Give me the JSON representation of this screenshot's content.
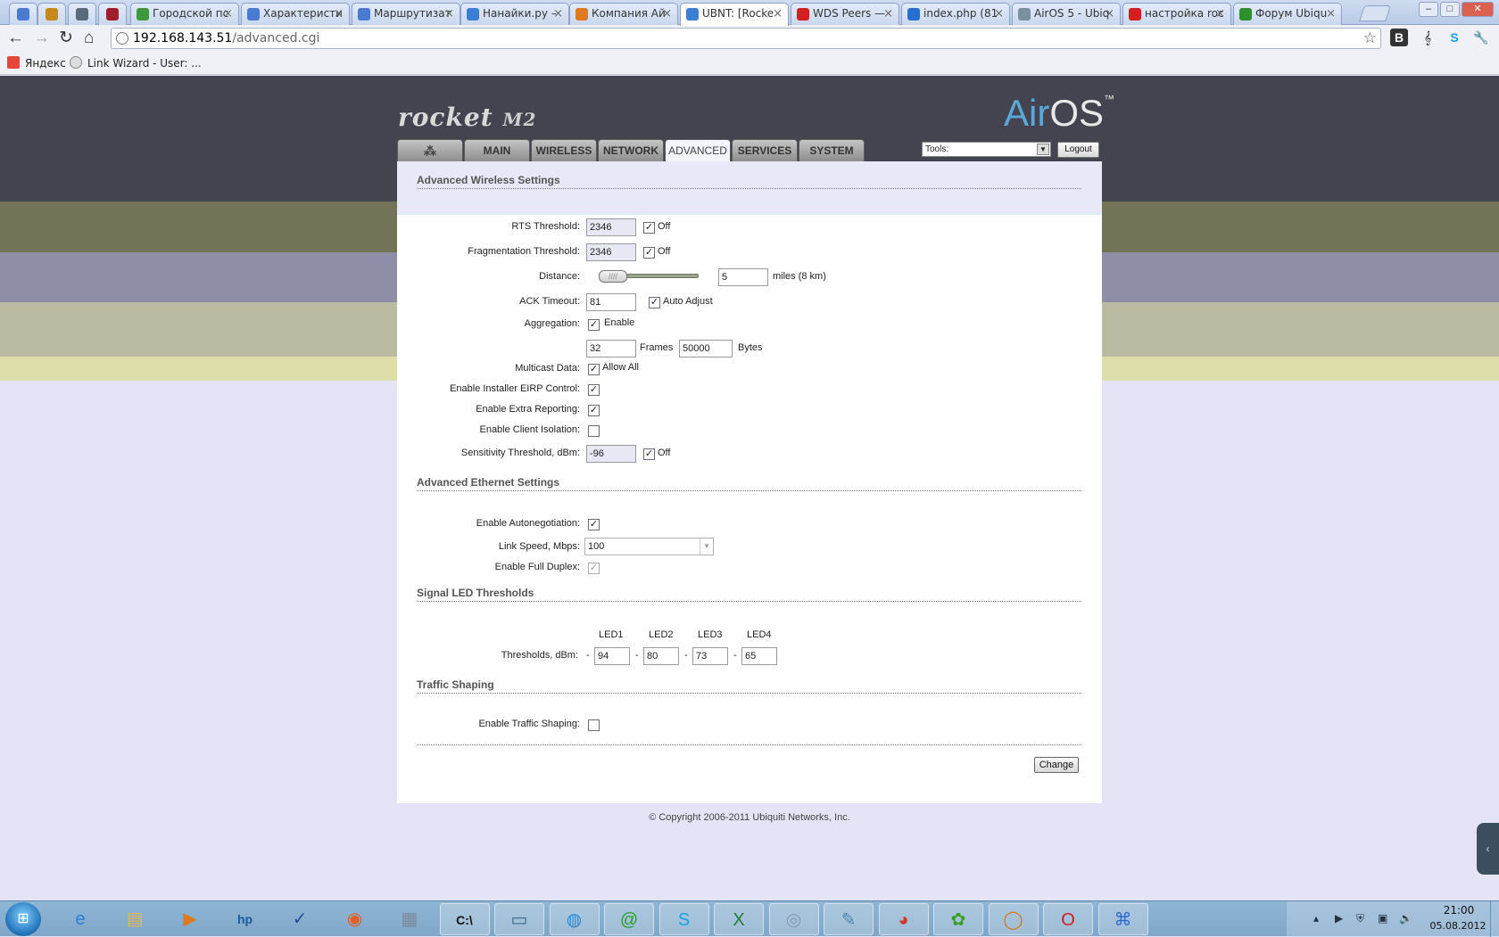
{
  "browser": {
    "tabs": [
      {
        "title": "",
        "icon": "generic-page-icon",
        "color": "#4a7bd0"
      },
      {
        "title": "",
        "icon": "emblem-icon",
        "color": "#c58a1a"
      },
      {
        "title": "",
        "icon": "building-icon",
        "color": "#5a6a7a"
      },
      {
        "title": "",
        "icon": "vote-icon",
        "color": "#9c1f2b"
      },
      {
        "title": "Городской пс",
        "icon": "figure-icon",
        "color": "#3b9a3b"
      },
      {
        "title": "Характеристи",
        "icon": "document-icon",
        "color": "#4a7bd0"
      },
      {
        "title": "Маршрутизат",
        "icon": "document-icon",
        "color": "#4a7bd0"
      },
      {
        "title": "Нанайки.ру –",
        "icon": "wifi-icon",
        "color": "#3a7fd5"
      },
      {
        "title": "Компания Ай",
        "icon": "circle-icon",
        "color": "#e07a1f"
      },
      {
        "title": "UBNT: [Rocke",
        "icon": "wifi-icon",
        "color": "#3a7fd5"
      },
      {
        "title": "WDS Peers —",
        "icon": "yandex-icon",
        "color": "#d21f1f"
      },
      {
        "title": "index.php (81",
        "icon": "nag-icon",
        "color": "#2a6fd0"
      },
      {
        "title": "AirOS 5 - Ubiq",
        "icon": "ubnt-icon",
        "color": "#7a8fa0"
      },
      {
        "title": "настройка roc",
        "icon": "yandex-icon",
        "color": "#d21f1f"
      },
      {
        "title": "Форум Ubiqu",
        "icon": "forum-icon",
        "color": "#2f8f2f"
      }
    ],
    "active_tab_index": 9,
    "window_buttons": [
      "–",
      "□",
      "✕"
    ],
    "nav": {
      "back": "←",
      "forward": "→",
      "reload": "↻",
      "home": "⌂"
    },
    "url_host": "192.168.143.51",
    "url_path": "/advanced.cgi",
    "star": "☆",
    "extensions": [
      {
        "glyph": "В",
        "icon": "vk-icon"
      },
      {
        "glyph": "𝄞",
        "icon": "music-icon"
      },
      {
        "glyph": "S",
        "icon": "skype-icon"
      },
      {
        "glyph": "🔧",
        "icon": "wrench-icon"
      }
    ],
    "bookmarks": [
      {
        "label": "Яндекс",
        "icon": "yandex-icon"
      },
      {
        "label": "Link Wizard - User: ...",
        "icon": "globe-icon"
      }
    ]
  },
  "airos": {
    "logo_rocket": "rocket",
    "logo_model": "M2",
    "logo_air": "Air",
    "logo_os": "OS",
    "logo_tm": "™",
    "nav_tabs": [
      {
        "label": "",
        "icon": "ubiquiti-logo-icon"
      },
      {
        "label": "MAIN"
      },
      {
        "label": "WIRELESS"
      },
      {
        "label": "NETWORK"
      },
      {
        "label": "ADVANCED"
      },
      {
        "label": "SERVICES"
      },
      {
        "label": "SYSTEM"
      }
    ],
    "active_nav_index": 4,
    "tools_label": "Tools:",
    "logout_label": "Logout",
    "accent": "#5aa8d8"
  },
  "wireless": {
    "title": "Advanced Wireless Settings",
    "rts_label": "RTS Threshold:",
    "rts_value": "2346",
    "rts_off_label": "Off",
    "frag_label": "Fragmentation Threshold:",
    "frag_value": "2346",
    "frag_off_label": "Off",
    "distance_label": "Distance:",
    "distance_value": "5",
    "distance_unit": "miles (8 km)",
    "ack_label": "ACK Timeout:",
    "ack_value": "81",
    "ack_auto_label": "Auto Adjust",
    "aggregation_label": "Aggregation:",
    "aggregation_enable_label": "Enable",
    "frames_value": "32",
    "frames_label": "Frames",
    "bytes_value": "50000",
    "bytes_label": "Bytes",
    "multicast_label": "Multicast Data:",
    "multicast_allow_label": "Allow All",
    "eirp_label": "Enable Installer EIRP Control:",
    "extra_reporting_label": "Enable Extra Reporting:",
    "client_isolation_label": "Enable Client Isolation:",
    "sensitivity_label": "Sensitivity Threshold, dBm:",
    "sensitivity_value": "-96",
    "sensitivity_off_label": "Off"
  },
  "ethernet": {
    "title": "Advanced Ethernet Settings",
    "autoneg_label": "Enable Autonegotiation:",
    "link_speed_label": "Link Speed, Mbps:",
    "link_speed_value": "100",
    "full_duplex_label": "Enable Full Duplex:"
  },
  "led": {
    "title": "Signal LED Thresholds",
    "headers": [
      "LED1",
      "LED2",
      "LED3",
      "LED4"
    ],
    "thresholds_label": "Thresholds, dBm:",
    "dash": "-",
    "values": [
      "94",
      "80",
      "73",
      "65"
    ]
  },
  "traffic": {
    "title": "Traffic Shaping",
    "enable_label": "Enable Traffic Shaping:"
  },
  "change_label": "Change",
  "copyright": "© Copyright 2006-2011 Ubiquiti Networks, Inc.",
  "taskbar": {
    "apps": [
      {
        "icon": "ie-icon",
        "glyph": "e",
        "color": "#2f7fd6"
      },
      {
        "icon": "explorer-icon",
        "glyph": "▤",
        "color": "#e8b840"
      },
      {
        "icon": "media-player-icon",
        "glyph": "▶",
        "color": "#e07a1f"
      },
      {
        "icon": "hp-icon",
        "glyph": "hp",
        "color": "#1a5aa0"
      },
      {
        "icon": "checkmark-app-icon",
        "glyph": "✓",
        "color": "#1f4f9a"
      },
      {
        "icon": "firefox-icon",
        "glyph": "◉",
        "color": "#e0602a"
      },
      {
        "icon": "calculator-icon",
        "glyph": "▦",
        "color": "#7a8a9a"
      },
      {
        "icon": "console-icon",
        "glyph": "C:\\",
        "color": "#111111"
      },
      {
        "icon": "monitor-icon",
        "glyph": "▭",
        "color": "#3a6a8a"
      },
      {
        "icon": "network-globe-icon",
        "glyph": "◍",
        "color": "#2a8ad0"
      },
      {
        "icon": "mail-agent-icon",
        "glyph": "@",
        "color": "#2aa02a"
      },
      {
        "icon": "skype-icon",
        "glyph": "S",
        "color": "#1ea0e0"
      },
      {
        "icon": "excel-icon",
        "glyph": "X",
        "color": "#1f7a3a"
      },
      {
        "icon": "disc-icon",
        "glyph": "◎",
        "color": "#8a9ab0"
      },
      {
        "icon": "notepad-icon",
        "glyph": "✎",
        "color": "#4a8ab0"
      },
      {
        "icon": "chrome-icon",
        "glyph": "◕",
        "color": "#d03a2a"
      },
      {
        "icon": "icq-icon",
        "glyph": "✿",
        "color": "#3aa02a"
      },
      {
        "icon": "ring-app-icon",
        "glyph": "◯",
        "color": "#d07a1a"
      },
      {
        "icon": "opera-icon",
        "glyph": "O",
        "color": "#c81f1f"
      },
      {
        "icon": "network-app-icon",
        "glyph": "⌘",
        "color": "#2a6ad0"
      }
    ],
    "tray": [
      {
        "icon": "tray-arrow-icon",
        "glyph": "▴"
      },
      {
        "icon": "flag-icon",
        "glyph": "▶"
      },
      {
        "icon": "antivirus-icon",
        "glyph": "⛨"
      },
      {
        "icon": "network-tray-icon",
        "glyph": "▣"
      },
      {
        "icon": "volume-icon",
        "glyph": "🔊"
      }
    ],
    "time": "21:00",
    "date": "05.08.2012"
  },
  "colors": {
    "page_bg": "#e4e4f6",
    "header_dark": "#444450",
    "band_olive": "#737357",
    "band_slate": "#8e8ea6",
    "band_khaki": "#bbbba3",
    "band_yellow": "#dedeaa"
  }
}
